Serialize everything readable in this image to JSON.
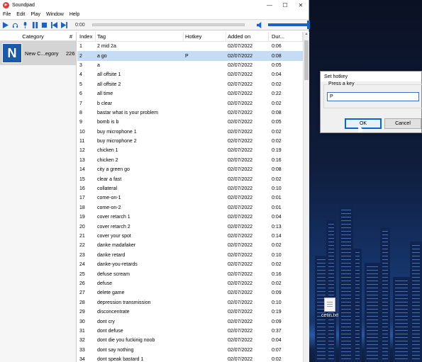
{
  "window": {
    "title": "Soundpad"
  },
  "menu": [
    "File",
    "Edit",
    "Play",
    "Window",
    "Help"
  ],
  "toolbar": {
    "time": "0:00"
  },
  "category_panel": {
    "header_category": "Category",
    "header_count": "#",
    "category": {
      "logo_letter": "N",
      "name": "New C...egory",
      "count": "226"
    }
  },
  "list": {
    "headers": {
      "index": "Index",
      "tag": "Tag",
      "hotkey": "Hotkey",
      "added": "Added on",
      "duration": "Dur..."
    },
    "rows": [
      {
        "i": "1",
        "tag": "2 mid 2a",
        "hotkey": "",
        "added": "02/07/2022",
        "dur": "0:06"
      },
      {
        "i": "2",
        "tag": "a go",
        "hotkey": "P",
        "added": "02/07/2022",
        "dur": "0:08"
      },
      {
        "i": "3",
        "tag": "a",
        "hotkey": "",
        "added": "02/07/2022",
        "dur": "0:05"
      },
      {
        "i": "4",
        "tag": "all offsite 1",
        "hotkey": "",
        "added": "02/07/2022",
        "dur": "0:04"
      },
      {
        "i": "5",
        "tag": "all offsite 2",
        "hotkey": "",
        "added": "02/07/2022",
        "dur": "0:02"
      },
      {
        "i": "6",
        "tag": "all time",
        "hotkey": "",
        "added": "02/07/2022",
        "dur": "0:22"
      },
      {
        "i": "7",
        "tag": "b clear",
        "hotkey": "",
        "added": "02/07/2022",
        "dur": "0:02"
      },
      {
        "i": "8",
        "tag": "bastar what is your problem",
        "hotkey": "",
        "added": "02/07/2022",
        "dur": "0:08"
      },
      {
        "i": "9",
        "tag": "bomb is b",
        "hotkey": "",
        "added": "02/07/2022",
        "dur": "0:05"
      },
      {
        "i": "10",
        "tag": "buy microphone 1",
        "hotkey": "",
        "added": "02/07/2022",
        "dur": "0:02"
      },
      {
        "i": "11",
        "tag": "buy microphone 2",
        "hotkey": "",
        "added": "02/07/2022",
        "dur": "0:02"
      },
      {
        "i": "12",
        "tag": "chicken 1",
        "hotkey": "",
        "added": "02/07/2022",
        "dur": "0:19"
      },
      {
        "i": "13",
        "tag": "chicken 2",
        "hotkey": "",
        "added": "02/07/2022",
        "dur": "0:16"
      },
      {
        "i": "14",
        "tag": "city a green go",
        "hotkey": "",
        "added": "02/07/2022",
        "dur": "0:08"
      },
      {
        "i": "15",
        "tag": "clear a fast",
        "hotkey": "",
        "added": "02/07/2022",
        "dur": "0:02"
      },
      {
        "i": "16",
        "tag": "collateral",
        "hotkey": "",
        "added": "02/07/2022",
        "dur": "0:10"
      },
      {
        "i": "17",
        "tag": "come-on-1",
        "hotkey": "",
        "added": "02/07/2022",
        "dur": "0:01"
      },
      {
        "i": "18",
        "tag": "come-on-2",
        "hotkey": "",
        "added": "02/07/2022",
        "dur": "0:01"
      },
      {
        "i": "19",
        "tag": "cover retarch 1",
        "hotkey": "",
        "added": "02/07/2022",
        "dur": "0:04"
      },
      {
        "i": "20",
        "tag": "cover retarch 2",
        "hotkey": "",
        "added": "02/07/2022",
        "dur": "0:13"
      },
      {
        "i": "21",
        "tag": "cover your spot",
        "hotkey": "",
        "added": "02/07/2022",
        "dur": "0:14"
      },
      {
        "i": "22",
        "tag": "danke madafaker",
        "hotkey": "",
        "added": "02/07/2022",
        "dur": "0:02"
      },
      {
        "i": "23",
        "tag": "danke retard",
        "hotkey": "",
        "added": "02/07/2022",
        "dur": "0:10"
      },
      {
        "i": "24",
        "tag": "danke-you-retards",
        "hotkey": "",
        "added": "02/07/2022",
        "dur": "0:02"
      },
      {
        "i": "25",
        "tag": "defuse scream",
        "hotkey": "",
        "added": "02/07/2022",
        "dur": "0:16"
      },
      {
        "i": "26",
        "tag": "defuse",
        "hotkey": "",
        "added": "02/07/2022",
        "dur": "0:02"
      },
      {
        "i": "27",
        "tag": "delete game",
        "hotkey": "",
        "added": "02/07/2022",
        "dur": "0:09"
      },
      {
        "i": "28",
        "tag": "depression transmission",
        "hotkey": "",
        "added": "02/07/2022",
        "dur": "0:10"
      },
      {
        "i": "29",
        "tag": "disconcentrate",
        "hotkey": "",
        "added": "02/07/2022",
        "dur": "0:19"
      },
      {
        "i": "30",
        "tag": "dont cry",
        "hotkey": "",
        "added": "02/07/2022",
        "dur": "0:09"
      },
      {
        "i": "31",
        "tag": "dont defuse",
        "hotkey": "",
        "added": "02/07/2022",
        "dur": "0:37"
      },
      {
        "i": "32",
        "tag": "dont die you fuckinig noob",
        "hotkey": "",
        "added": "02/07/2022",
        "dur": "0:04"
      },
      {
        "i": "33",
        "tag": "dont say nothing",
        "hotkey": "",
        "added": "02/07/2022",
        "dur": "0:07"
      },
      {
        "i": "34",
        "tag": "dont speak bastard 1",
        "hotkey": "",
        "added": "02/07/2022",
        "dur": "0:02"
      }
    ]
  },
  "dialog": {
    "title": "Set hotkey",
    "group_label": "Press a key",
    "hotkey_value": "P",
    "ok_label": "OK",
    "cancel_label": "Cancel"
  },
  "desktop": {
    "file_label": "cetin.txt"
  }
}
